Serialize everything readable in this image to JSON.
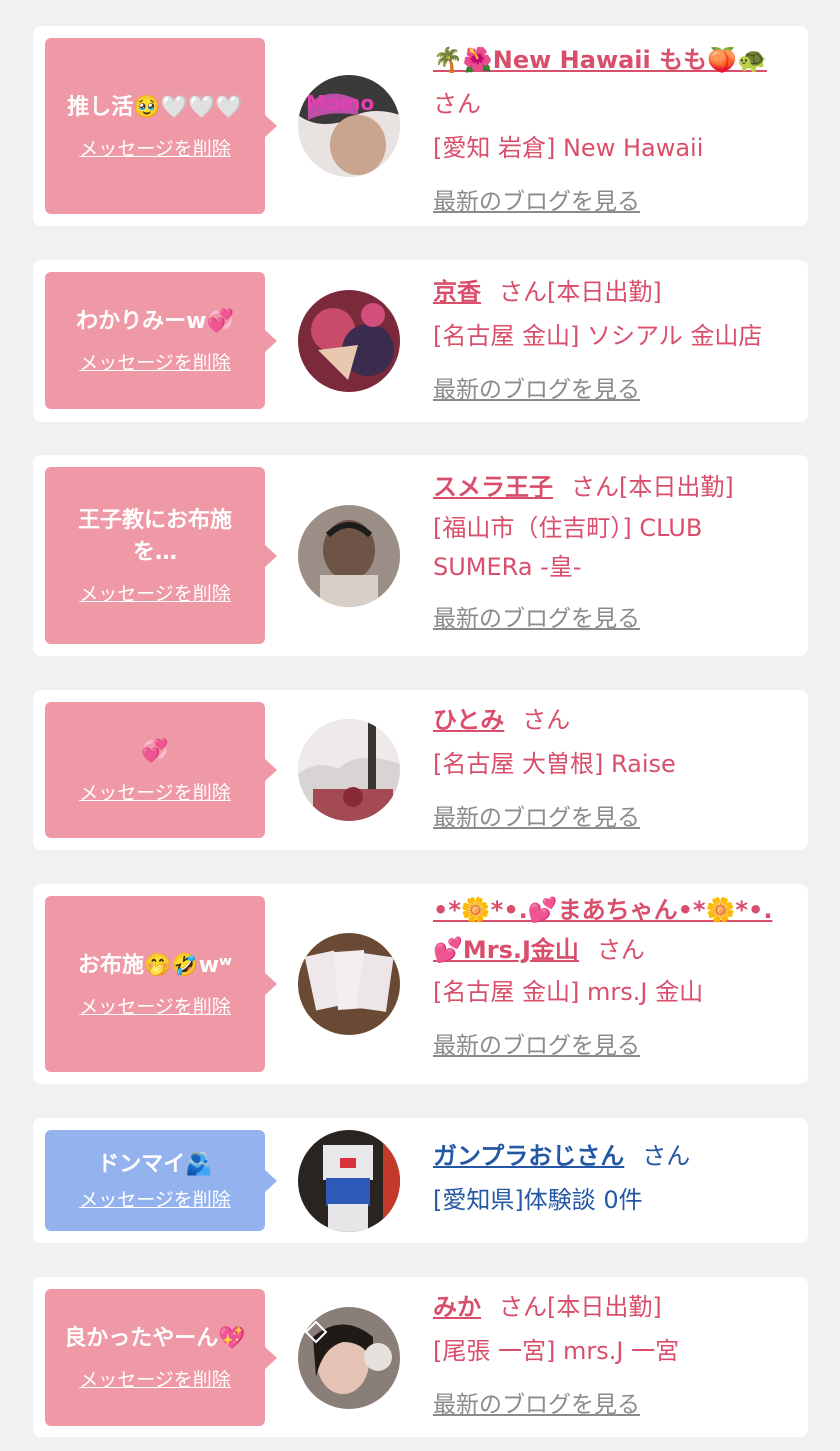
{
  "delete_label": "メッセージを削除",
  "blog_label": "最新のブログを見る",
  "san": "さん",
  "cards": [
    {
      "message": "推し活🥹🤍🤍🤍",
      "name": "🌴🌺New Hawaii もも🍑🐢",
      "status": "",
      "shop": "[愛知 岩倉] New Hawaii",
      "has_blog": true
    },
    {
      "message": "わかりみーw💞",
      "name": "京香",
      "status": "[本日出勤]",
      "shop": "[名古屋 金山] ソシアル 金山店",
      "has_blog": true
    },
    {
      "message": "王子教にお布施を…",
      "name": "スメラ王子",
      "status": "[本日出勤]",
      "shop": "[福山市（住吉町）] CLUB SUMERa -皇-",
      "has_blog": true
    },
    {
      "message": "💞",
      "name": "ひとみ",
      "status": "",
      "shop": "[名古屋 大曽根] Raise",
      "has_blog": true
    },
    {
      "message": "お布施🤭🤣wʷ",
      "name": "•*🌼*•.💕まあちゃん•*🌼*•.💕Mrs.J金山",
      "status": "",
      "shop": "[名古屋 金山] mrs.J 金山",
      "has_blog": true
    },
    {
      "message": "ドンマイ🫂",
      "name": "ガンプラおじさん",
      "status": "",
      "shop": "[愛知県]体験談 0件",
      "has_blog": false
    },
    {
      "message": "良かったやーん💖",
      "name": "みか",
      "status": "[本日出勤]",
      "shop": "[尾張 一宮] mrs.J 一宮",
      "has_blog": true
    }
  ],
  "colors": {
    "pink_bubble": "#ee99a5",
    "blue_bubble": "#94b3ee",
    "name_red": "#d94f6b",
    "name_blue": "#2457a4",
    "blog_gray": "#8b8b8b",
    "background": "#f1f1f1"
  }
}
